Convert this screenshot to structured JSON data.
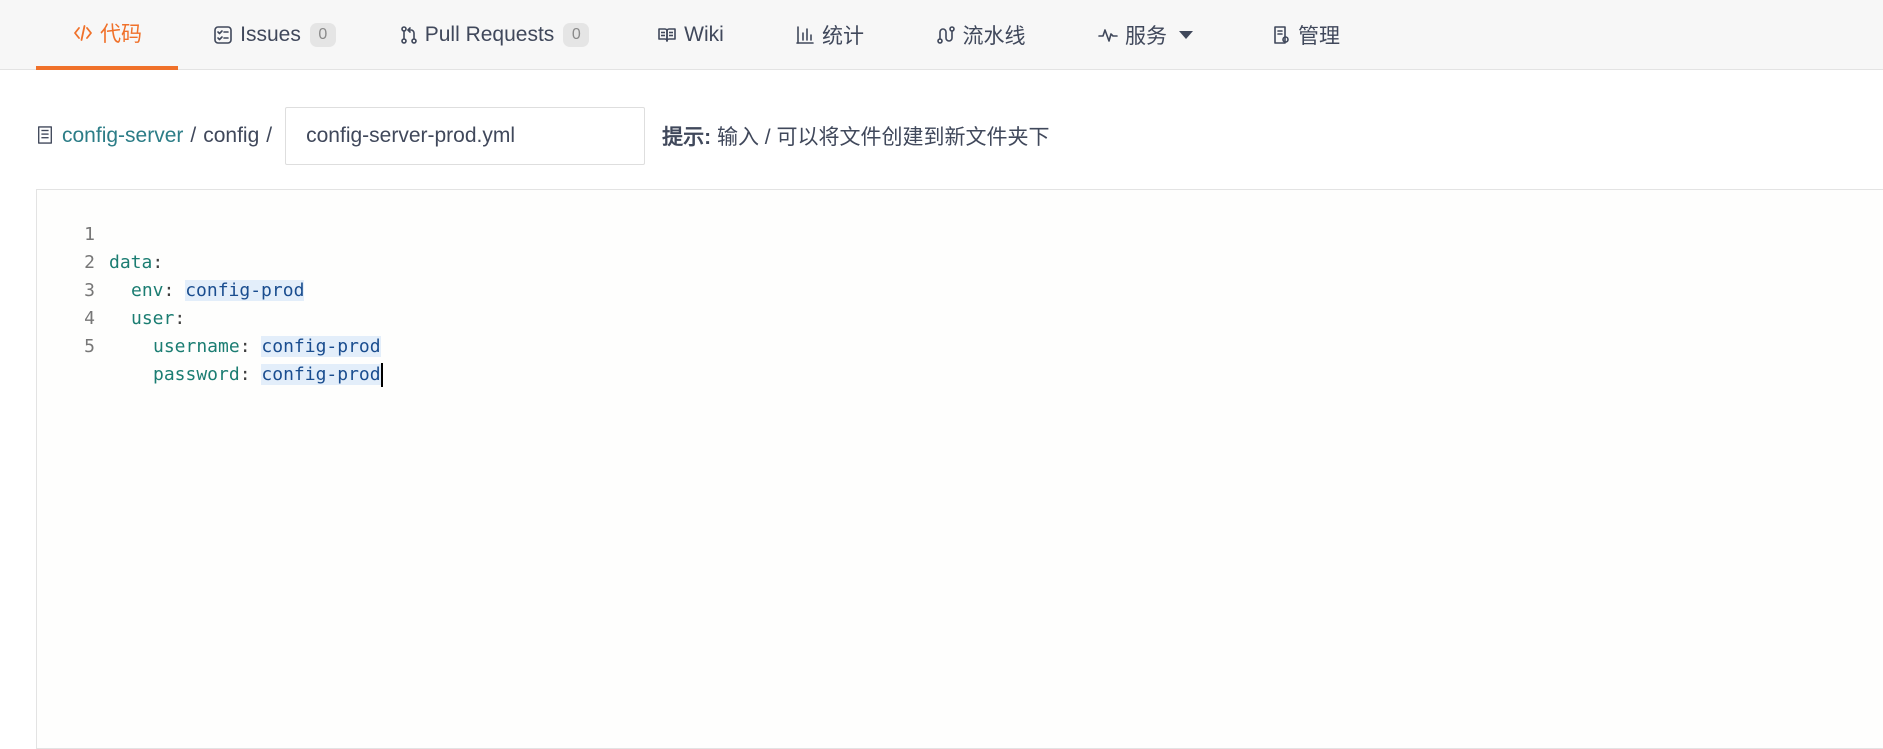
{
  "tabs": [
    {
      "label": "代码",
      "icon": "code-icon",
      "active": true
    },
    {
      "label": "Issues",
      "icon": "issues-icon",
      "badge": "0"
    },
    {
      "label": "Pull Requests",
      "icon": "pull-request-icon",
      "badge": "0"
    },
    {
      "label": "Wiki",
      "icon": "book-icon"
    },
    {
      "label": "统计",
      "icon": "bar-chart-icon"
    },
    {
      "label": "流水线",
      "icon": "pipeline-icon"
    },
    {
      "label": "服务",
      "icon": "pulse-icon",
      "dropdown": true
    },
    {
      "label": "管理",
      "icon": "settings-doc-icon"
    }
  ],
  "path": {
    "repo": "config-server",
    "separator": "/",
    "folder": "config",
    "filename_value": "config-server-prod.yml",
    "hint_label": "提示:",
    "hint_text": "输入 / 可以将文件创建到新文件夹下"
  },
  "editor": {
    "lines": [
      {
        "number": "1",
        "key": "data",
        "punct": ":",
        "value": ""
      },
      {
        "number": "2",
        "key": "env",
        "punct": ": ",
        "value": "config-prod"
      },
      {
        "number": "3",
        "key": "user",
        "punct": ":",
        "value": ""
      },
      {
        "number": "4",
        "key": "username",
        "punct": ": ",
        "value": "config-prod"
      },
      {
        "number": "5",
        "key": "password",
        "punct": ": ",
        "value": "config-prod"
      }
    ]
  },
  "colors": {
    "accent": "#f0712a",
    "link": "#2c7d87",
    "yaml_key": "#1b7d72",
    "yaml_value": "#1a4d8f"
  }
}
